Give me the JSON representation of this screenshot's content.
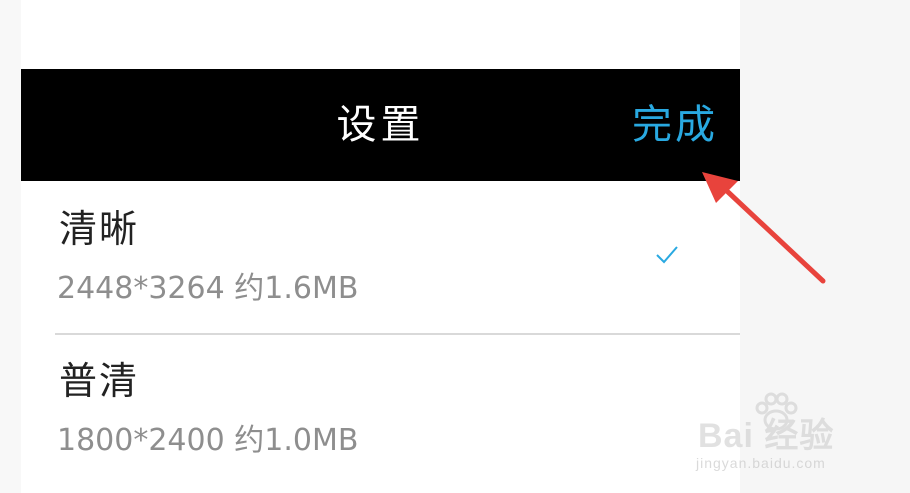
{
  "header": {
    "title": "设置",
    "done_label": "完成"
  },
  "options": [
    {
      "name": "清晰",
      "detail": "2448*3264 约1.6MB",
      "selected": true
    },
    {
      "name": "普清",
      "detail": "1800*2400 约1.0MB",
      "selected": false
    }
  ],
  "watermark": {
    "brand": "Bai 经验",
    "url": "jingyan.baidu.com"
  },
  "colors": {
    "header_bg": "#000000",
    "header_title": "#ffffff",
    "accent": "#29a9e1",
    "annotation_arrow": "#e8433c"
  },
  "icons": {
    "check": "checkmark-icon",
    "annotation": "red-arrow-icon",
    "watermark": "baidu-paw-icon"
  }
}
